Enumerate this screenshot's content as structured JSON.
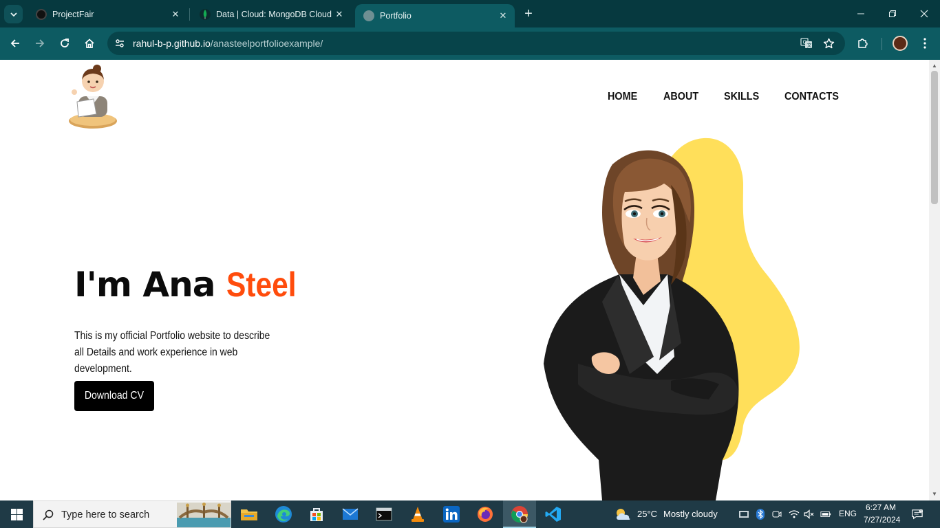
{
  "browser": {
    "tabs": [
      {
        "title": "ProjectFair",
        "active": false
      },
      {
        "title": "Data | Cloud: MongoDB Cloud",
        "active": false
      },
      {
        "title": "Portfolio",
        "active": true
      }
    ],
    "address": {
      "host": "rahul-b-p.github.io",
      "path": "/anasteelportfolioexample/"
    }
  },
  "site": {
    "nav": [
      "HOME",
      "ABOUT",
      "SKILLS",
      "CONTACTS"
    ],
    "hero": {
      "title_prefix": "I'm Ana ",
      "title_highlight": "Steel",
      "description": "This is my official Portfolio website to describe all Details and work experience in web development.",
      "button_label": "Download CV"
    },
    "colors": {
      "accent": "#ff4c0c",
      "blob": "#ffdf5a",
      "button": "#000000"
    }
  },
  "taskbar": {
    "search_placeholder": "Type here to search",
    "weather": {
      "temp": "25°C",
      "condition": "Mostly cloudy"
    },
    "language": "ENG",
    "time": "6:27 AM",
    "date": "7/27/2024"
  }
}
